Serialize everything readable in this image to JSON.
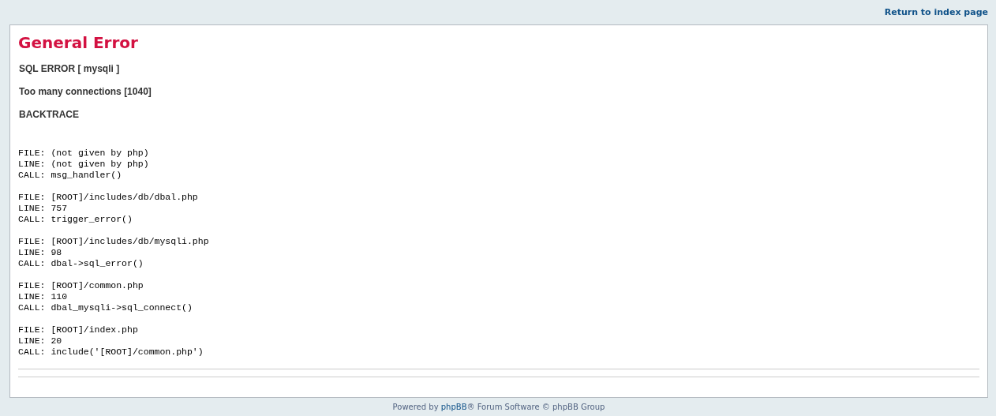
{
  "top_link": "Return to index page",
  "title": "General Error",
  "messages": [
    "SQL ERROR [ mysqli ]",
    "Too many connections [1040]",
    "BACKTRACE"
  ],
  "backtrace": [
    [
      "FILE: (not given by php)",
      "LINE: (not given by php)",
      "CALL: msg_handler()"
    ],
    [
      "FILE: [ROOT]/includes/db/dbal.php",
      "LINE: 757",
      "CALL: trigger_error()"
    ],
    [
      "FILE: [ROOT]/includes/db/mysqli.php",
      "LINE: 98",
      "CALL: dbal->sql_error()"
    ],
    [
      "FILE: [ROOT]/common.php",
      "LINE: 110",
      "CALL: dbal_mysqli->sql_connect()"
    ],
    [
      "FILE: [ROOT]/index.php",
      "LINE: 20",
      "CALL: include('[ROOT]/common.php')"
    ]
  ],
  "footer": {
    "before": "Powered by ",
    "link": "phpBB",
    "after": "® Forum Software © phpBB Group"
  }
}
